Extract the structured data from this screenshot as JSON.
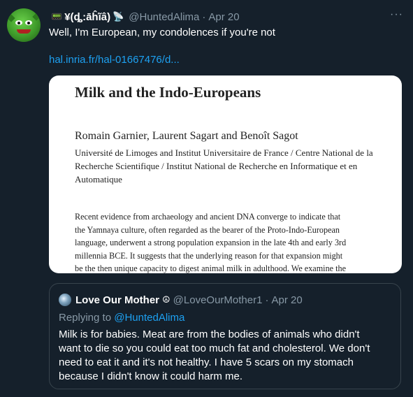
{
  "tweet": {
    "display_name": "¥(ȡ:āĥĩâ)",
    "name_prefix_icon": "📟",
    "name_suffix_icon": "📡",
    "handle": "@HuntedAlima",
    "date": "Apr 20",
    "separator": "·",
    "more_icon": "···",
    "text": "Well, I'm European, my condolences if you're not",
    "link": "hal.inria.fr/hal-01667476/d..."
  },
  "document": {
    "title": "Milk and the Indo-Europeans",
    "authors": "Romain Garnier, Laurent Sagart and Benoît Sagot",
    "affiliation": "Université de Limoges and Institut Universitaire de France / Centre National de la Recherche Scientifique / Institut National de Recherche en Informatique et en Automatique",
    "abstract_lines": [
      "Recent evidence from archaeology and ancient DNA converge to indicate that",
      "the Yamnaya culture, often regarded as the bearer of the Proto-Indo-European",
      "language, underwent a strong population expansion in the late 4th and early 3rd",
      "millennia BCE. It suggests that the underlying reason for that expansion might",
      "be the then unique capacity to digest animal milk in adulthood. We examine the"
    ]
  },
  "quoted": {
    "display_name": "Love Our Mother",
    "badge_icon": "☮",
    "handle": "@LoveOurMother1",
    "separator": "·",
    "date": "Apr 20",
    "replying_prefix": "Replying to ",
    "replying_handle": "@HuntedAlima",
    "text_lines": [
      "Milk is for babies.  Meat are from the bodies of animals who didn't",
      "want to die so you could eat too much fat and cholesterol.  We don't",
      "need to eat it and it's not healthy. I have 5 scars on my stomach",
      "because I didn't know it could harm me."
    ]
  }
}
